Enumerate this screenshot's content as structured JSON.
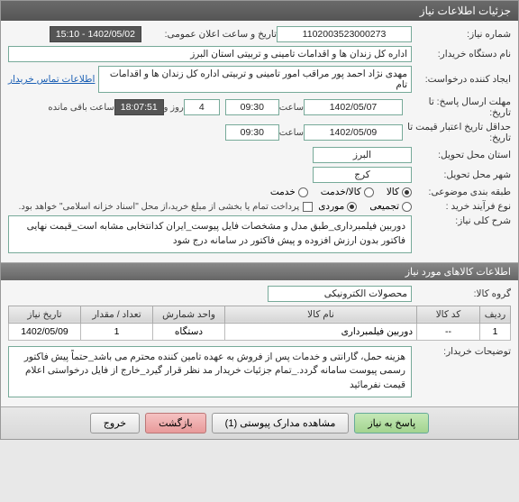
{
  "window_title": "جزئیات اطلاعات نیاز",
  "fields": {
    "need_no_label": "شماره نیاز:",
    "need_no": "1102003523000273",
    "announce_label": "تاریخ و ساعت اعلان عمومی:",
    "announce_val": "1402/05/02 - 15:10",
    "buyer_org_label": "نام دستگاه خریدار:",
    "buyer_org": "اداره کل زندان ها و اقدامات تامینی و تربیتی استان البرز",
    "requester_label": "ایجاد کننده درخواست:",
    "requester": "مهدی نژاد احمد پور مراقب امور تامینی و تربیتی اداره کل زندان ها و اقدامات تام",
    "contact_link": "اطلاعات تماس خریدار",
    "deadline_label": "مهلت ارسال پاسخ: تا تاریخ:",
    "deadline_date": "1402/05/07",
    "time_word": "ساعت",
    "deadline_time": "09:30",
    "days_val": "4",
    "days_word": "روز و",
    "countdown": "18:07:51",
    "remaining": "ساعت باقی مانده",
    "validity_label": "حداقل تاریخ اعتبار قیمت تا تاریخ:",
    "validity_date": "1402/05/09",
    "validity_time": "09:30",
    "province_label": "استان محل تحویل:",
    "province": "البرز",
    "city_label": "شهر محل تحویل:",
    "city": "کرج",
    "topic_label": "طبقه بندی موضوعی:",
    "topic_goods": "کالا",
    "topic_service": "کالا/خدمت",
    "topic_svc": "خدمت",
    "buy_type_label": "نوع فرآیند خرید :",
    "buy_type_opt1": "تجمیعی",
    "buy_type_opt2": "موردی",
    "pay_note": "پرداخت تمام یا بخشی از مبلغ خرید،از محل \"اسناد خزانه اسلامی\" خواهد بود.",
    "desc_label": "شرح کلی نیاز:",
    "desc_text": "دوربین فیلمبرداری_طبق مدل و مشخصات فایل پیوست_ایران کدانتخابی مشابه است_قیمت نهایی فاکتور بدون ارزش افزوده و پیش فاکتور در سامانه درج شود"
  },
  "items_header": "اطلاعات کالاهای مورد نیاز",
  "group_label": "گروه کالا:",
  "group_val": "محصولات الکترونیکی",
  "table": {
    "headers": [
      "ردیف",
      "کد کالا",
      "نام کالا",
      "واحد شمارش",
      "تعداد / مقدار",
      "تاریخ نیاز"
    ],
    "rows": [
      {
        "n": "1",
        "code": "--",
        "name": "دوربین فیلمبرداری",
        "unit": "دستگاه",
        "qty": "1",
        "date": "1402/05/09"
      }
    ]
  },
  "buyer_notes_label": "توضیحات خریدار:",
  "buyer_notes": "هزینه حمل، گارانتی و خدمات پس از فروش به عهده تامین کننده محترم می باشد_حتماً پیش فاکتور رسمی پیوست سامانه گردد._تمام جزئیات خریدار مد نظر قرار گیرد_خارج از فایل درخواستی اعلام قیمت نفرمائید",
  "buttons": {
    "respond": "پاسخ به نیاز",
    "attachments": "مشاهده مدارک پیوستی (1)",
    "back": "بازگشت",
    "exit": "خروج"
  }
}
